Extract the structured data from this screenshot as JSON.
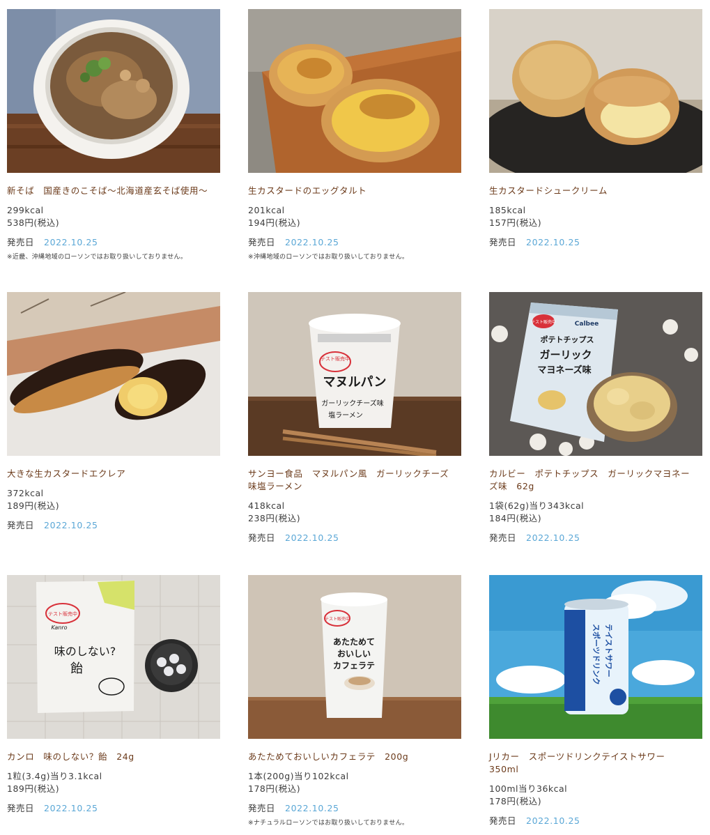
{
  "release_label": "発売日",
  "products": [
    {
      "name": "新そば　国産きのこそば～北海道産玄そば使用～",
      "kcal": "299kcal",
      "price": "538円(税込)",
      "date": "2022.10.25",
      "note": "※近畿、沖縄地域のローソンではお取り扱いしておりません。"
    },
    {
      "name": "生カスタードのエッグタルト",
      "kcal": "201kcal",
      "price": "194円(税込)",
      "date": "2022.10.25",
      "note": "※沖縄地域のローソンではお取り扱いしておりません。"
    },
    {
      "name": "生カスタードシュークリーム",
      "kcal": "185kcal",
      "price": "157円(税込)",
      "date": "2022.10.25",
      "note": ""
    },
    {
      "name": "大きな生カスタードエクレア",
      "kcal": "372kcal",
      "price": "189円(税込)",
      "date": "2022.10.25",
      "note": ""
    },
    {
      "name": "サンヨー食品　マヌルパン風　ガーリックチーズ味塩ラーメン",
      "kcal": "418kcal",
      "price": "238円(税込)",
      "date": "2022.10.25",
      "note": ""
    },
    {
      "name": "カルビー　ポテトチップス　ガーリックマヨネーズ味　62g",
      "kcal": "1袋(62g)当り343kcal",
      "price": "184円(税込)",
      "date": "2022.10.25",
      "note": ""
    },
    {
      "name": "カンロ　味のしない？飴　24g",
      "kcal": "1粒(3.4g)当り3.1kcal",
      "price": "189円(税込)",
      "date": "2022.10.25",
      "note": ""
    },
    {
      "name": "あたためておいしいカフェラテ　200g",
      "kcal": "1本(200g)当り102kcal",
      "price": "178円(税込)",
      "date": "2022.10.25",
      "note": "※ナチュラルローソンではお取り扱いしておりません。"
    },
    {
      "name": "Jリカー　スポーツドリンクテイストサワー　350ml",
      "kcal": "100ml当り36kcal",
      "price": "178円(税込)",
      "date": "2022.10.25",
      "note": ""
    }
  ],
  "package_text": {
    "test_badge": "テスト販売中",
    "manuru_brand": "マヌルパン",
    "manuru_sub": "ガーリックチーズ味",
    "manuru_sub2": "塩ラーメン",
    "calbee_logo": "Calbee",
    "calbee_line1": "ポテトチップス",
    "calbee_line2": "ガーリック",
    "calbee_line3": "マヨネーズ味",
    "kanro_logo": "Kanro",
    "kanro_title": "味のしない?",
    "kanro_title2": "飴",
    "cafe_line1": "あたためて",
    "cafe_line2": "おいしい",
    "cafe_line3": "カフェラテ",
    "can_text": "スポーツドリンク",
    "can_text2": "テイストサワー"
  },
  "colors": {
    "name_text": "#6b3a1a",
    "date_text": "#5aa7d6",
    "body_text": "#3c3c3c"
  }
}
